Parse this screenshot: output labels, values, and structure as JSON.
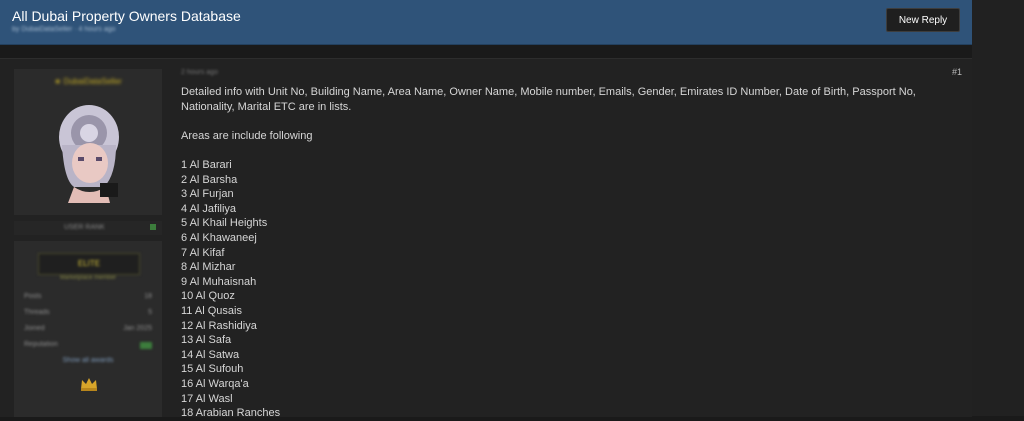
{
  "thread": {
    "title": "All Dubai Property Owners Database",
    "byline": "by DubaiDataSeller · 4 hours ago",
    "new_reply_label": "New Reply"
  },
  "user": {
    "username": "★ DubaiDataSeller",
    "rank": "USER RANK",
    "badge": "ELITE",
    "badge_sub": "Marketplace member",
    "stats": [
      {
        "label": "Posts",
        "value": "18"
      },
      {
        "label": "Threads",
        "value": "5"
      },
      {
        "label": "Joined",
        "value": "Jan 2025"
      },
      {
        "label": "Reputation",
        "value": "10"
      }
    ],
    "extra_link": "Show all awards"
  },
  "post": {
    "date": "2 hours ago",
    "number": "#1",
    "intro": "Detailed info with Unit No, Building Name, Area Name, Owner Name, Mobile number, Emails, Gender, Emirates ID Number, Date of Birth, Passport No, Nationality, Marital ETC are in lists.",
    "areas_heading": "Areas are include following",
    "areas": [
      "1 Al Barari",
      "2 Al Barsha",
      "3 Al Furjan",
      "4 Al Jafiliya",
      "5 Al Khail Heights",
      "6 Al Khawaneej",
      "7 Al Kifaf",
      "8 Al Mizhar",
      "9 Al Muhaisnah",
      "10 Al Quoz",
      "11 Al Qusais",
      "12 Al Rashidiya",
      "13 Al Safa",
      "14 Al Satwa",
      "15 Al Sufouh",
      "16 Al Warqa'a",
      "17 Al Wasl",
      "18 Arabian Ranches"
    ]
  },
  "colors": {
    "header_bg": "#2f5379",
    "page_bg": "#1a1a1a",
    "panel_bg": "#222222",
    "accent_gold": "#c9b026",
    "reputation_green": "#3c7d3c"
  }
}
